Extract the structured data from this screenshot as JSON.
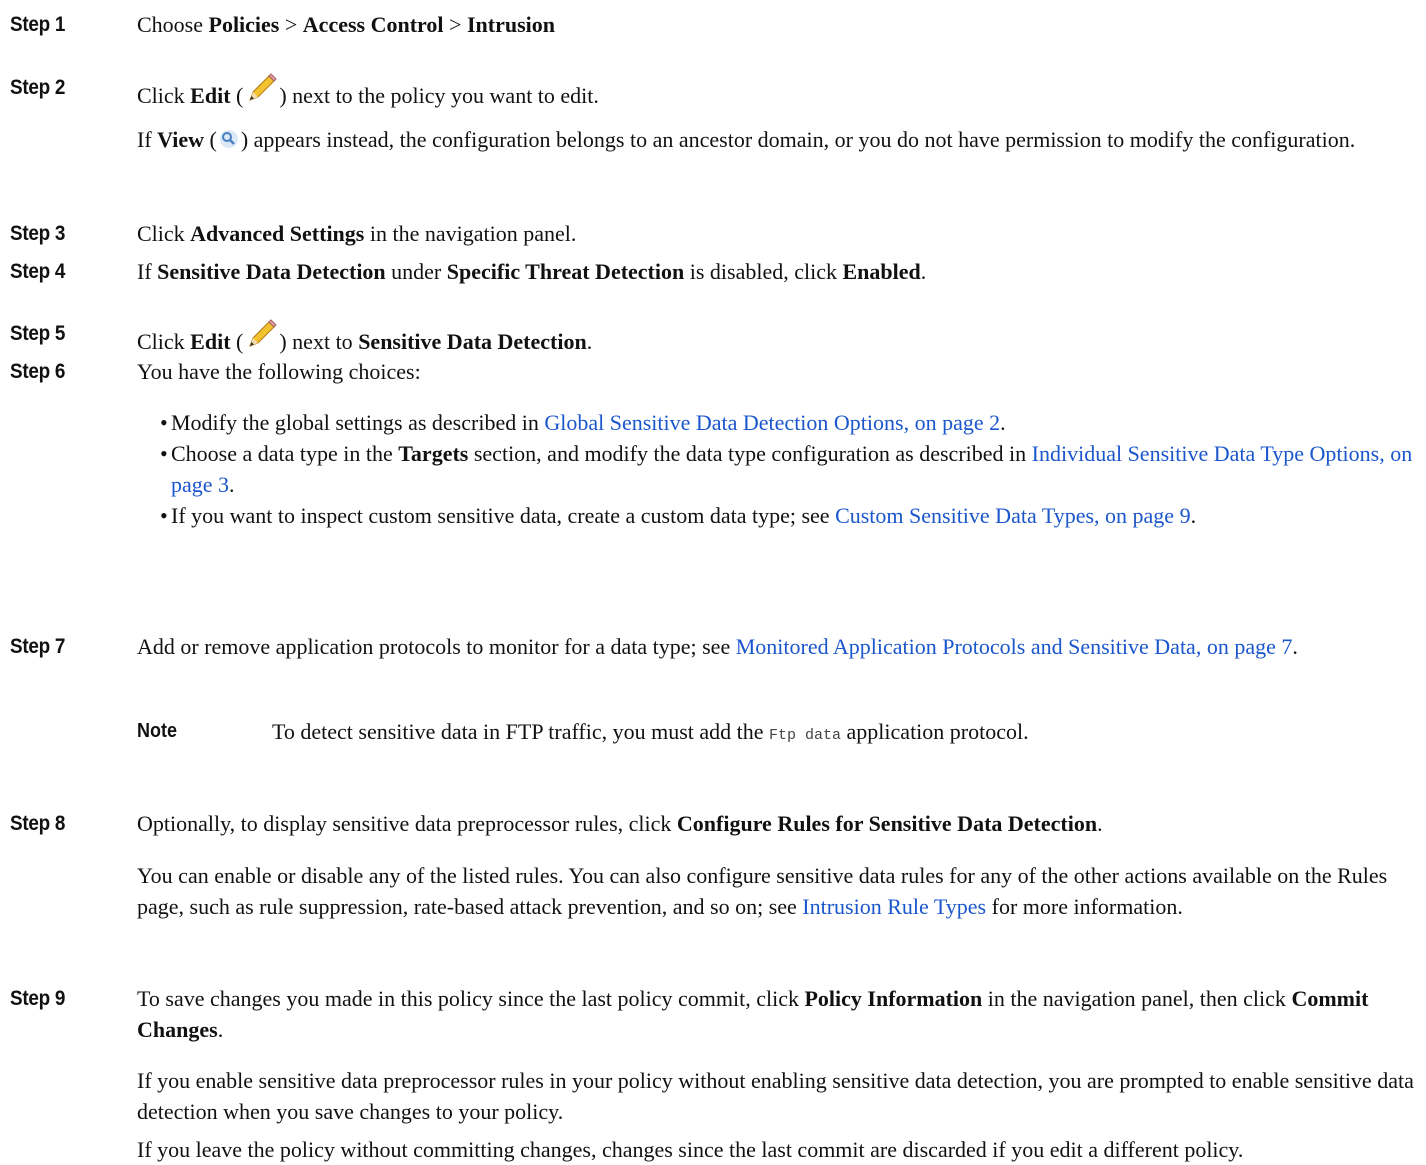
{
  "step1": {
    "label": "Step 1",
    "choose": "Choose",
    "policies": "Policies",
    "sep": ">",
    "access_control": "Access Control",
    "intrusion": "Intrusion"
  },
  "step2": {
    "label": "Step 2",
    "click": "Click",
    "edit": "Edit",
    "open_paren": "(",
    "after_icon": ") next to the policy you want to edit.",
    "if": "If",
    "view": "View",
    "view_rest": ") appears instead, the configuration belongs to an ancestor domain, or you do not have permission to modify the configuration."
  },
  "step3": {
    "label": "Step 3",
    "click": "Click",
    "advanced_settings": "Advanced Settings",
    "rest": "in the navigation panel."
  },
  "step4": {
    "label": "Step 4",
    "if": "If",
    "sensitive_data_detection": "Sensitive Data Detection",
    "under": "under",
    "specific_threat_detection": "Specific Threat Detection",
    "is_disabled": "is disabled, click",
    "enabled": "Enabled",
    "period": "."
  },
  "step5": {
    "label": "Step 5",
    "click": "Click",
    "edit": "Edit",
    "open_paren": "(",
    "next_to": ") next to",
    "sensitive_data_detection": "Sensitive Data Detection",
    "period": "."
  },
  "step6": {
    "label": "Step 6",
    "intro": "You have the following choices:",
    "bullet1_text": "Modify the global settings as described in",
    "bullet1_link": "Global Sensitive Data Detection Options, on page 2",
    "bullet2_a": "Choose a data type in the",
    "bullet2_targets": "Targets",
    "bullet2_b": "section, and modify the data type configuration as described in",
    "bullet2_link": "Individual Sensitive Data Type Options, on page 3",
    "bullet3_text": "If you want to inspect custom sensitive data, create a custom data type; see",
    "bullet3_link": "Custom Sensitive Data Types, on page 9",
    "period": "."
  },
  "step7": {
    "label": "Step 7",
    "text": "Add or remove application protocols to monitor for a data type; see",
    "link": "Monitored Application Protocols and Sensitive Data, on page 7",
    "period": ".",
    "note_label": "Note",
    "note_a": "To detect sensitive data in FTP traffic, you must add the",
    "note_code": "Ftp data",
    "note_b": "application protocol."
  },
  "step8": {
    "label": "Step 8",
    "text": "Optionally, to display sensitive data preprocessor rules, click",
    "bold": "Configure Rules for Sensitive Data Detection",
    "period": ".",
    "para_a": "You can enable or disable any of the listed rules. You can also configure sensitive data rules for any of the other actions available on the Rules page, such as rule suppression, rate-based attack prevention, and so on; see",
    "para_link": "Intrusion Rule Types",
    "para_b": "for more information."
  },
  "step9": {
    "label": "Step 9",
    "text_a": "To save changes you made in this policy since the last policy commit, click",
    "policy_information": "Policy Information",
    "text_b": "in the navigation panel, then click",
    "commit_changes": "Commit Changes",
    "period": ".",
    "para1": "If you enable sensitive data preprocessor rules in your policy without enabling sensitive data detection, you are prompted to enable sensitive data detection when you save changes to your policy.",
    "para2": "If you leave the policy without committing changes, changes since the last commit are discarded if you edit a different policy."
  },
  "icons": {
    "edit": "pencil-icon",
    "view": "magnifier-icon"
  }
}
